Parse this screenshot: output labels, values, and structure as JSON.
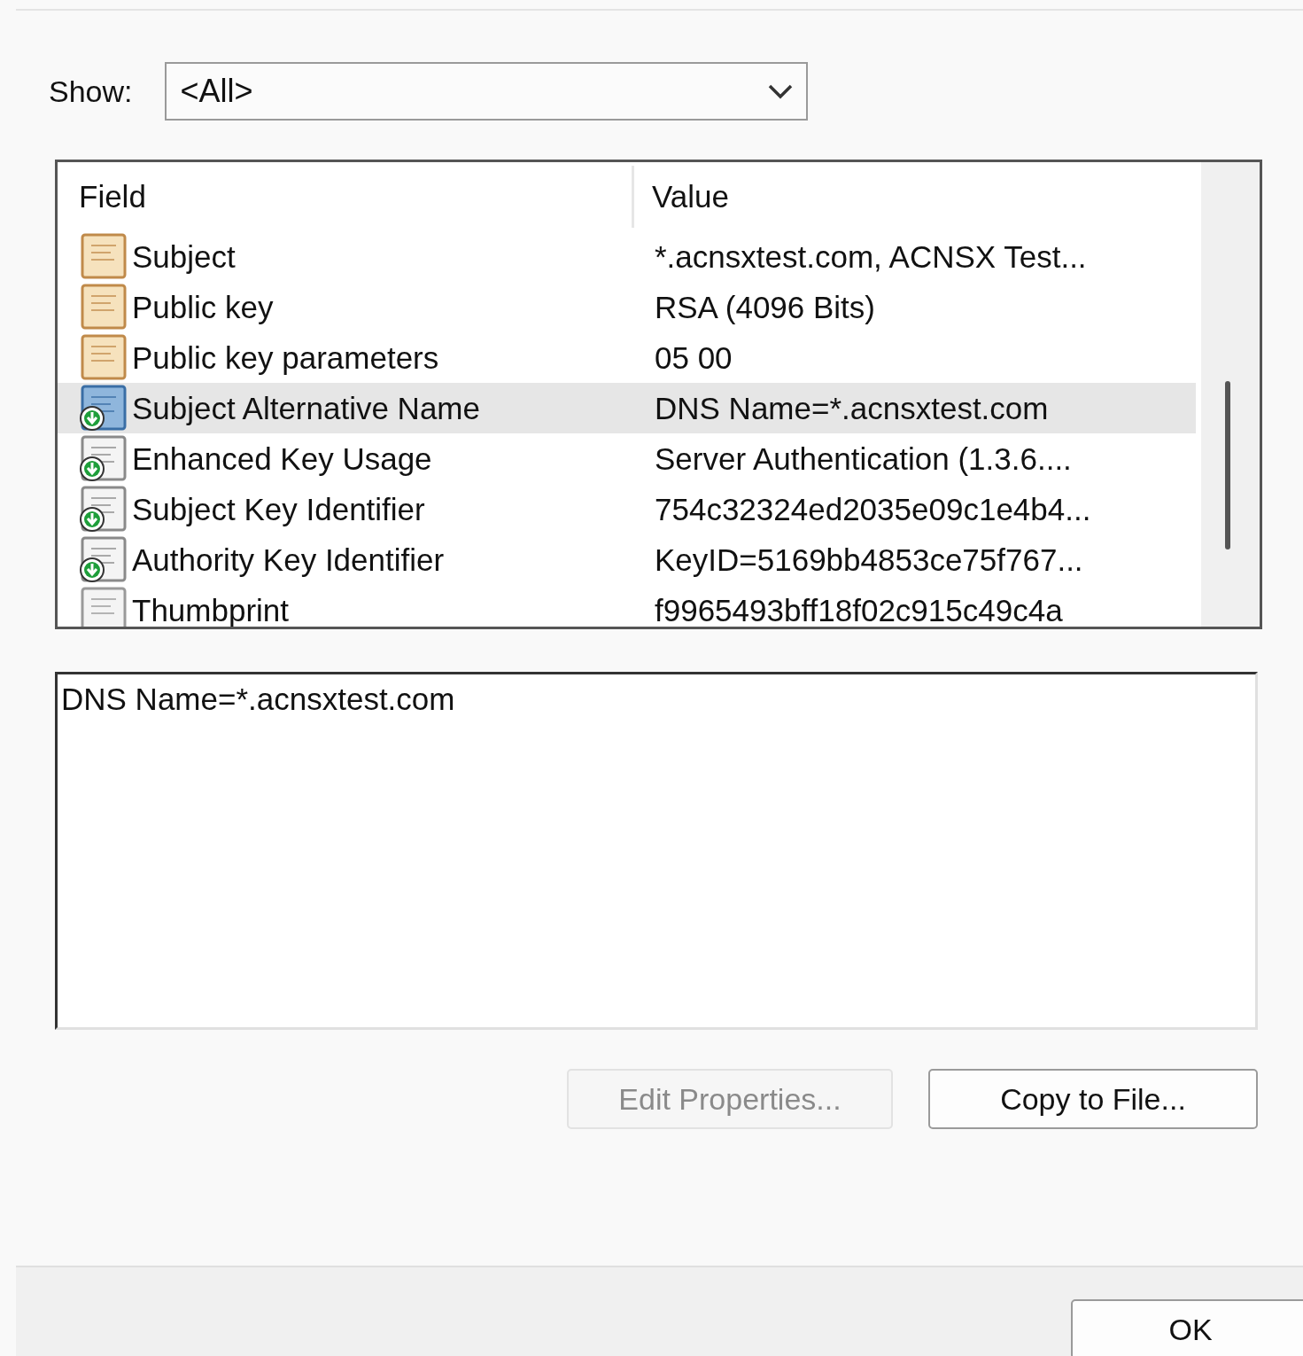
{
  "show": {
    "label": "Show:",
    "value": "<All>"
  },
  "fields": {
    "columns": [
      "Field",
      "Value"
    ],
    "rows": [
      {
        "kind": "property",
        "field": "Subject",
        "value": "*.acnsxtest.com, ACNSX Test...",
        "selected": false
      },
      {
        "kind": "property",
        "field": "Public key",
        "value": "RSA (4096 Bits)",
        "selected": false
      },
      {
        "kind": "property",
        "field": "Public key parameters",
        "value": "05 00",
        "selected": false
      },
      {
        "kind": "extension",
        "field": "Subject Alternative Name",
        "value": "DNS Name=*.acnsxtest.com",
        "selected": true
      },
      {
        "kind": "extension",
        "field": "Enhanced Key Usage",
        "value": "Server Authentication (1.3.6....",
        "selected": false
      },
      {
        "kind": "extension",
        "field": "Subject Key Identifier",
        "value": "754c32324ed2035e09c1e4b4...",
        "selected": false
      },
      {
        "kind": "extension",
        "field": "Authority Key Identifier",
        "value": "KeyID=5169bb4853ce75f767...",
        "selected": false
      },
      {
        "kind": "plain",
        "field": "Thumbprint",
        "value": "f9965493bff18f02c915c49c4a",
        "selected": false
      }
    ]
  },
  "detail": {
    "value": "DNS Name=*.acnsxtest.com"
  },
  "buttons": [
    {
      "label": "Edit Properties...",
      "disabled": true
    },
    {
      "label": "Copy to File...",
      "disabled": false
    }
  ],
  "footer_buttons": [
    {
      "label": "OK",
      "disabled": false
    }
  ]
}
